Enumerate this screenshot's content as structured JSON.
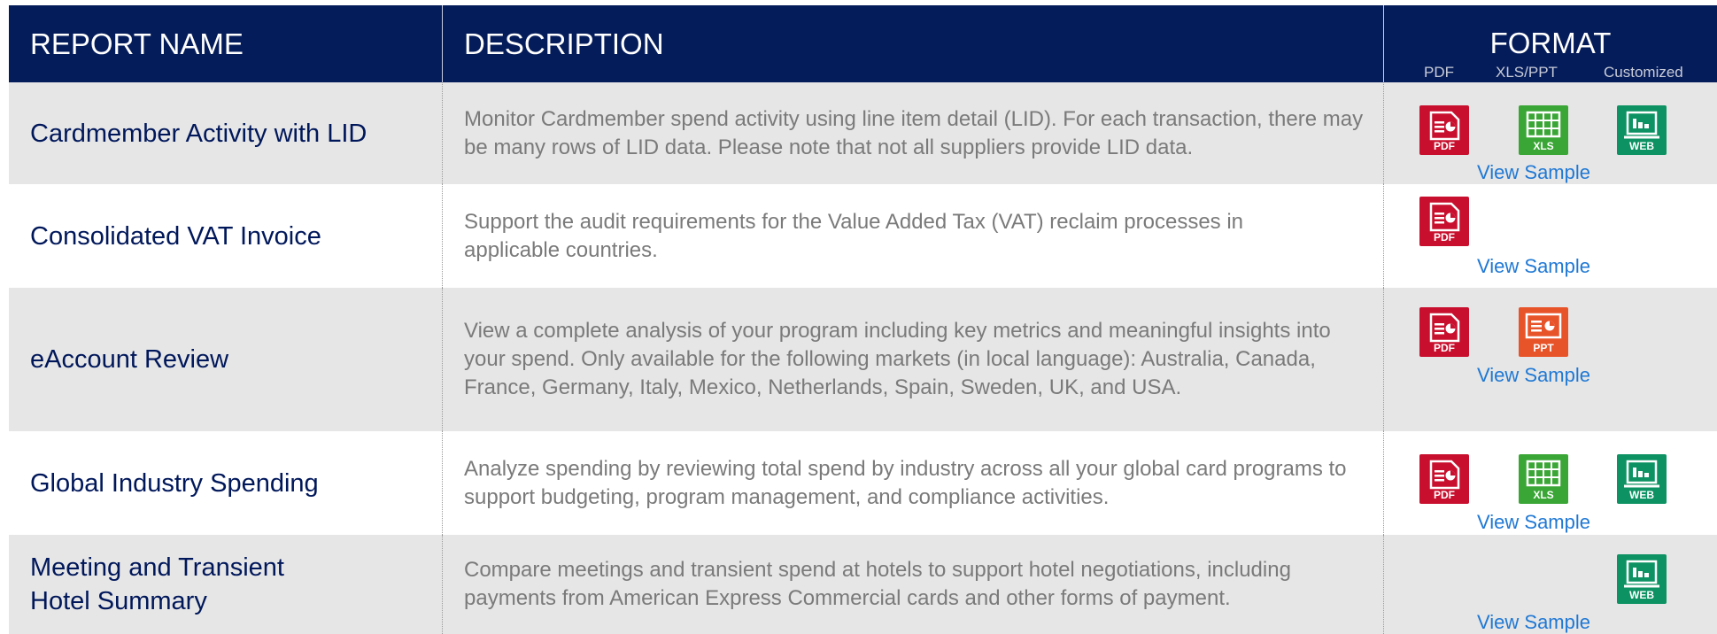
{
  "header": {
    "col_name": "REPORT NAME",
    "col_desc": "DESCRIPTION",
    "col_format": "FORMAT",
    "sub_pdf": "PDF",
    "sub_xls": "XLS/PPT",
    "sub_custom": "Customized"
  },
  "rows": [
    {
      "name": "Cardmember Activity with LID",
      "desc": "Monitor Cardmember spend activity using line item detail (LID). For each transaction, there may be many rows of LID data. Please note that not all suppliers provide LID data.",
      "formats": [
        "PDF",
        "XLS",
        "WEB"
      ],
      "link": "View Sample"
    },
    {
      "name": "Consolidated VAT Invoice",
      "desc": "Support the audit requirements for the Value Added Tax (VAT) reclaim processes in applicable countries.",
      "formats": [
        "PDF"
      ],
      "link": "View Sample"
    },
    {
      "name": "eAccount Review",
      "desc": "View a complete analysis of your program including key metrics and meaningful insights into your spend. Only available for the following markets (in local language): Australia, Canada, France, Germany, Italy, Mexico, Netherlands, Spain, Sweden, UK, and USA.",
      "formats": [
        "PDF",
        "PPT"
      ],
      "link": "View Sample"
    },
    {
      "name": "Global Industry Spending",
      "desc": "Analyze spending by reviewing total spend by industry across all your global card programs to support budgeting, program management, and compliance activities.",
      "formats": [
        "PDF",
        "XLS",
        "WEB"
      ],
      "link": "View Sample"
    },
    {
      "name": "Meeting and Transient Hotel Summary",
      "desc": "Compare meetings and transient spend at hotels to support hotel negotiations, including payments from American Express Commercial cards and other forms of payment.",
      "formats": [
        "WEB"
      ],
      "link": "View Sample"
    }
  ],
  "colors": {
    "header_bg": "#051c5a",
    "name_text": "#00175a",
    "pdf": "#c8102e",
    "xls": "#3aa635",
    "ppt": "#e8542a",
    "web": "#0c9263",
    "link": "#1f78d4"
  }
}
